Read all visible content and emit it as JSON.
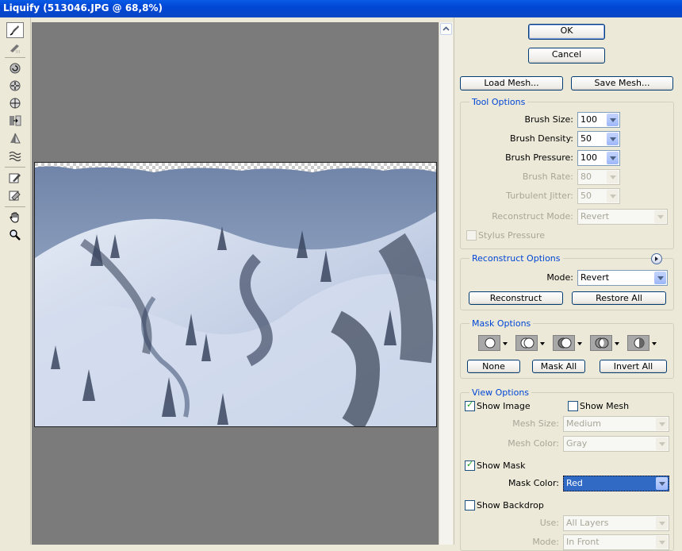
{
  "window": {
    "title": "Liquify (513046.JPG @ 68,8%)"
  },
  "tools": [
    {
      "name": "forward-warp-icon"
    },
    {
      "name": "reconstruct-icon"
    },
    {
      "name": "twirl-clockwise-icon"
    },
    {
      "name": "pucker-icon"
    },
    {
      "name": "bloat-icon"
    },
    {
      "name": "push-left-icon"
    },
    {
      "name": "mirror-icon"
    },
    {
      "name": "turbulence-icon"
    },
    {
      "name": "freeze-mask-icon"
    },
    {
      "name": "thaw-mask-icon"
    },
    {
      "name": "hand-icon"
    },
    {
      "name": "zoom-icon"
    }
  ],
  "buttons": {
    "ok": "OK",
    "cancel": "Cancel",
    "load_mesh": "Load Mesh...",
    "save_mesh": "Save Mesh..."
  },
  "tool_options": {
    "legend": "Tool Options",
    "brush_size_label": "Brush Size:",
    "brush_size": "100",
    "brush_density_label": "Brush Density:",
    "brush_density": "50",
    "brush_pressure_label": "Brush Pressure:",
    "brush_pressure": "100",
    "brush_rate_label": "Brush Rate:",
    "brush_rate": "80",
    "turbulent_jitter_label": "Turbulent Jitter:",
    "turbulent_jitter": "50",
    "reconstruct_mode_label": "Reconstruct Mode:",
    "reconstruct_mode": "Revert",
    "stylus_pressure_label": "Stylus Pressure"
  },
  "reconstruct_options": {
    "legend": "Reconstruct Options",
    "mode_label": "Mode:",
    "mode": "Revert",
    "reconstruct_button": "Reconstruct",
    "restore_all_button": "Restore All"
  },
  "mask_options": {
    "legend": "Mask Options",
    "none_button": "None",
    "mask_all_button": "Mask All",
    "invert_all_button": "Invert All"
  },
  "view_options": {
    "legend": "View Options",
    "show_image_label": "Show Image",
    "show_image": true,
    "show_mesh_label": "Show Mesh",
    "show_mesh": false,
    "mesh_size_label": "Mesh Size:",
    "mesh_size": "Medium",
    "mesh_color_label": "Mesh Color:",
    "mesh_color": "Gray",
    "show_mask_label": "Show Mask",
    "show_mask": true,
    "mask_color_label": "Mask Color:",
    "mask_color": "Red",
    "show_backdrop_label": "Show Backdrop",
    "show_backdrop": false,
    "use_label": "Use:",
    "use": "All Layers",
    "mode_label": "Mode:",
    "mode": "In Front"
  },
  "colors": {
    "titlebar": "#0a5ce6",
    "accent": "#0046d5",
    "canvas": "#7b7b7b"
  }
}
